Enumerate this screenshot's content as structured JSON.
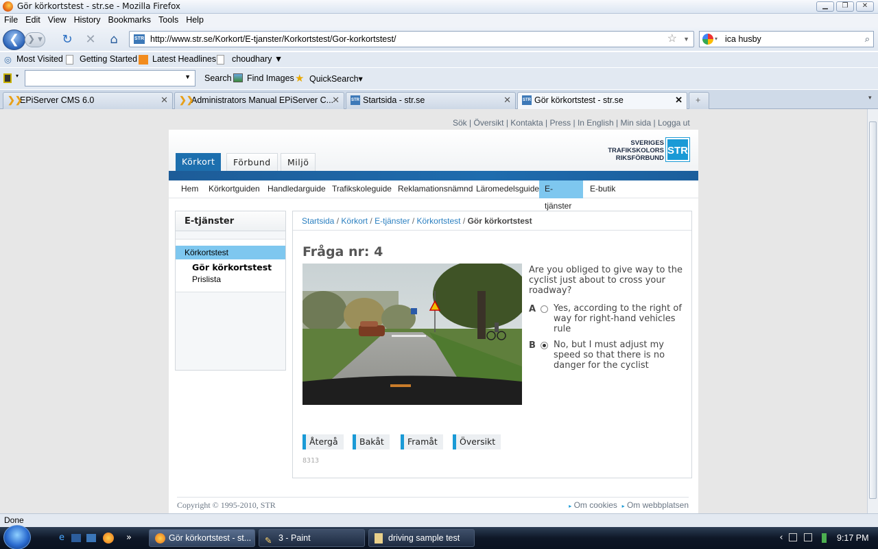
{
  "window": {
    "title": "Gör körkortstest - str.se - Mozilla Firefox"
  },
  "menu": [
    "File",
    "Edit",
    "View",
    "History",
    "Bookmarks",
    "Tools",
    "Help"
  ],
  "nav": {
    "url": "http://www.str.se/Korkort/E-tjanster/Korkortstest/Gor-korkortstest/",
    "search_value": "ica husby"
  },
  "bookmarks": [
    "Most Visited",
    "Getting Started",
    "Latest Headlines",
    "choudhary ▼"
  ],
  "toolbar3": {
    "search_label": "Search",
    "find_images": "Find Images",
    "quicksearch": "QuickSearch▾"
  },
  "tabs": [
    {
      "label": "EPiServer CMS 6.0"
    },
    {
      "label": "Administrators Manual EPiServer C..."
    },
    {
      "label": "Startsida - str.se"
    },
    {
      "label": "Gör körkortstest - str.se"
    }
  ],
  "site": {
    "toplinks": [
      "Sök",
      "Översikt",
      "Kontakta",
      "Press",
      "In English",
      "Min sida",
      "Logga ut"
    ],
    "logo_text": [
      "SVERIGES",
      "TRAFIKSKOLORS",
      "RIKSFÖRBUND"
    ],
    "logo_box": "STR",
    "main_tabs": [
      "Körkort",
      "Förbund",
      "Miljö"
    ],
    "subnav": [
      "Hem",
      "Körkortguiden",
      "Handledarguide",
      "Trafikskoleguide",
      "Reklamationsnämnd",
      "Läromedelsguide",
      "E-tjänster",
      "E-butik"
    ],
    "sidebar": {
      "title": "E-tjänster",
      "section": "Körkortstest",
      "items": [
        "Gör körkortstest",
        "Prislista"
      ]
    },
    "breadcrumb": [
      "Startsida",
      "Körkort",
      "E-tjänster",
      "Körkortstest",
      "Gör körkortstest"
    ],
    "question": {
      "title": "Fråga nr: 4",
      "text": "Are you obliged to give way to the cyclist just about to cross your roadway?",
      "options": [
        {
          "letter": "A",
          "text": "Yes, according to the right of way for right-hand vehicles rule",
          "selected": false
        },
        {
          "letter": "B",
          "text": "No, but I must adjust my speed so that there is no danger for the cyclist",
          "selected": true
        }
      ],
      "id": "8313"
    },
    "buttons": [
      "Återgå",
      "Bakåt",
      "Framåt",
      "Översikt"
    ],
    "footer": {
      "copyright": "Copyright © 1995-2010, STR",
      "links": [
        "Om cookies",
        "Om webbplatsen"
      ]
    }
  },
  "status": "Done",
  "taskbar": {
    "tasks": [
      "Gör körkortstest - st...",
      "3 - Paint",
      "driving sample test"
    ],
    "clock": "9:17 PM"
  }
}
